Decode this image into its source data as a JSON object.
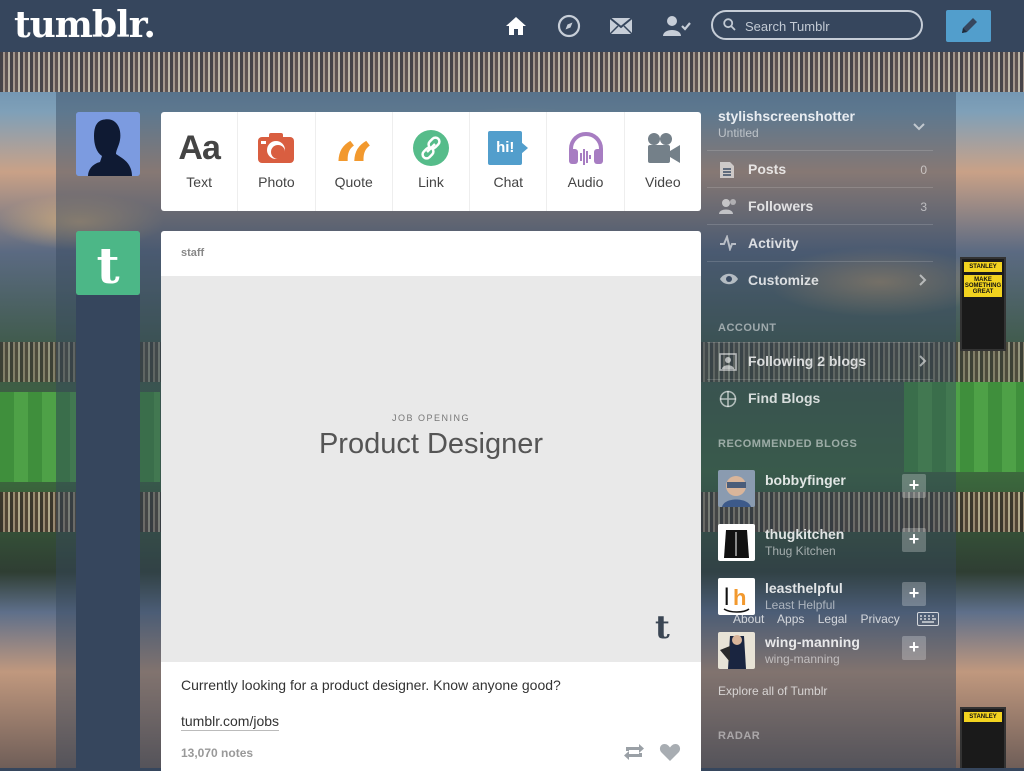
{
  "brand": {
    "logo": "tumblr."
  },
  "nav": {
    "search_placeholder": "Search Tumblr",
    "icons": [
      "home-icon",
      "explore-icon",
      "inbox-icon",
      "account-icon",
      "compose-icon"
    ]
  },
  "post_form": {
    "items": [
      {
        "label": "Text",
        "glyph": "Aa",
        "color": "#444444"
      },
      {
        "label": "Photo",
        "color": "#d95e40"
      },
      {
        "label": "Quote",
        "glyph": "“",
        "color": "#f2992e"
      },
      {
        "label": "Link",
        "color": "#56bc8a"
      },
      {
        "label": "Chat",
        "glyph": "hi!",
        "color": "#529ecc"
      },
      {
        "label": "Audio",
        "color": "#a77dc2"
      },
      {
        "label": "Video",
        "color": "#748089"
      }
    ]
  },
  "post": {
    "author": "staff",
    "kicker": "JOB OPENING",
    "headline": "Product Designer",
    "caption": "Currently looking for a product designer. Know anyone good?",
    "link": "tumblr.com/jobs",
    "notes": "13,070 notes",
    "tumblr_mark": "t"
  },
  "sidebar": {
    "blog_name": "stylishscreenshotter",
    "blog_title": "Untitled",
    "rows": [
      {
        "label": "Posts",
        "count": "0"
      },
      {
        "label": "Followers",
        "count": "3"
      },
      {
        "label": "Activity",
        "count": ""
      },
      {
        "label": "Customize",
        "count": ""
      }
    ],
    "account_heading": "ACCOUNT",
    "account_rows": [
      {
        "label": "Following 2 blogs"
      },
      {
        "label": "Find Blogs"
      }
    ],
    "recommended_heading": "RECOMMENDED BLOGS",
    "recommended": [
      {
        "name": "bobbyfinger",
        "title": ""
      },
      {
        "name": "thugkitchen",
        "title": "Thug Kitchen"
      },
      {
        "name": "leasthelpful",
        "title": "Least Helpful"
      },
      {
        "name": "wing-manning",
        "title": "wing-manning"
      }
    ],
    "footer_links": [
      "About",
      "Apps",
      "Legal",
      "Privacy"
    ],
    "explore": "Explore all of Tumblr",
    "radar_heading": "RADAR"
  }
}
